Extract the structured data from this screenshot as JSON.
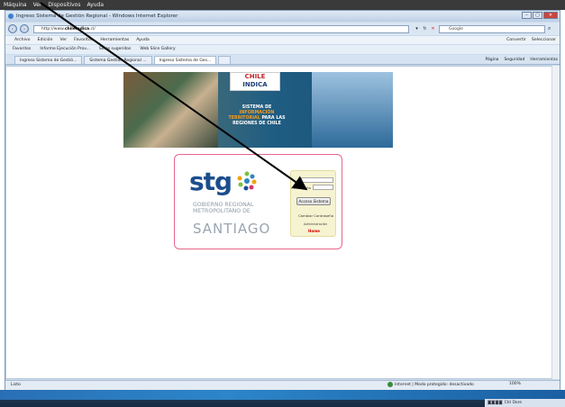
{
  "vm_menu": [
    "Máquina",
    "Ver",
    "Dispositivos",
    "Ayuda"
  ],
  "window": {
    "title": "Ingreso Sistema de Gestión Regional - Windows Internet Explorer",
    "buttons": [
      "–",
      "▢",
      "✕"
    ]
  },
  "address": {
    "prefix": "http://www.",
    "domain": "chileindica",
    ".suffix": ".cl/",
    "value_suffix": ".cl/"
  },
  "search": {
    "placeholder": "Google"
  },
  "menubar": {
    "items": [
      "Archivo",
      "Edición",
      "Ver",
      "Favoritos",
      "Herramientas",
      "Ayuda"
    ],
    "right": [
      "Convertir",
      "Seleccionar"
    ]
  },
  "favorites": {
    "items": [
      "Favoritos",
      "Informe Ejecución Prov...",
      "Sitios sugeridos",
      "Web Slice Gallery"
    ]
  },
  "tabs": [
    {
      "label": "Ingreso Sistema de Gestió..."
    },
    {
      "label": "Sistema Gestión Regional ..."
    },
    {
      "label": "Ingreso Sistema de Ges..."
    }
  ],
  "commandbar": [
    "Página",
    "Seguridad",
    "Herramientas"
  ],
  "banner": {
    "logo_line1": "CHILE",
    "logo_line2": "INDICA",
    "text_line1": "SISTEMA DE",
    "text_hl1": "INFORMACIÓN",
    "text_hl2": "TERRITORIAL",
    "text_line2": "PARA LAS",
    "text_line3": "REGIONES DE CHILE"
  },
  "login": {
    "wordmark": "stg",
    "subtitle": "GOBIERNO REGIONAL METROPOLITANO DE",
    "city": "SANTIAGO",
    "password_label": "Contraseña",
    "access_button": "Acceso Sistema",
    "change_password": "Cambiar Contraseña",
    "admin": "Administración",
    "home": "Home"
  },
  "status": {
    "left": "Listo",
    "zone": "Internet | Modo protegido: desactivado",
    "zoom": "100%"
  },
  "tray": {
    "lang": "Ctrl Dere"
  }
}
